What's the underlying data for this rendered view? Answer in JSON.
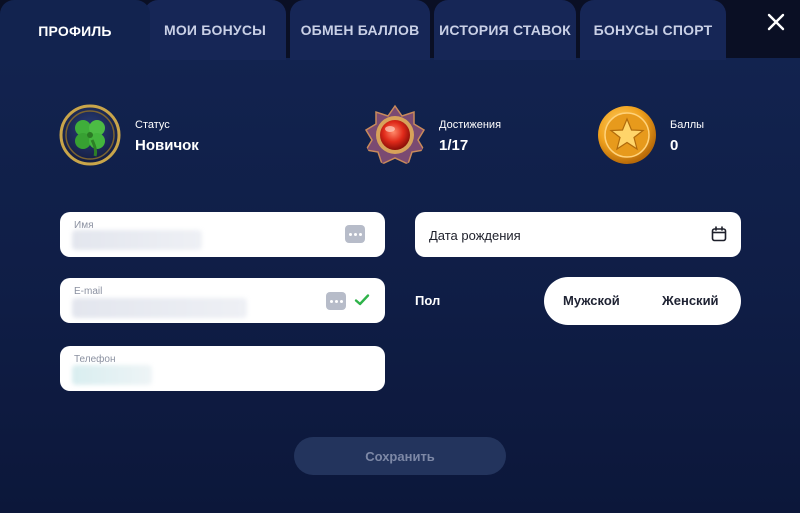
{
  "tabs": [
    {
      "label": "ПРОФИЛЬ",
      "active": true
    },
    {
      "label": "МОИ БОНУСЫ",
      "active": false
    },
    {
      "label": "ОБМЕН БАЛЛОВ",
      "active": false
    },
    {
      "label": "ИСТОРИЯ СТАВОК",
      "active": false
    },
    {
      "label": "БОНУСЫ СПОРТ",
      "active": false
    }
  ],
  "close_icon": "close-icon",
  "stats": {
    "status": {
      "label": "Статус",
      "value": "Новичок",
      "icon": "clover-badge-icon"
    },
    "achievements": {
      "label": "Достижения",
      "value": "1/17",
      "icon": "medal-icon"
    },
    "points": {
      "label": "Баллы",
      "value": "0",
      "icon": "star-coin-icon"
    }
  },
  "form": {
    "name": {
      "label": "Имя"
    },
    "email": {
      "label": "E-mail"
    },
    "phone": {
      "label": "Телефон"
    },
    "birthdate": {
      "placeholder": "Дата рождения"
    },
    "gender": {
      "label": "Пол",
      "options": [
        "Мужской",
        "Женский"
      ]
    },
    "save_label": "Сохранить"
  },
  "colors": {
    "background": "#0d1a3e",
    "tab": "#162656",
    "active_tab": "#12234f",
    "check": "#2fb34a",
    "save_button": "#23345d"
  }
}
